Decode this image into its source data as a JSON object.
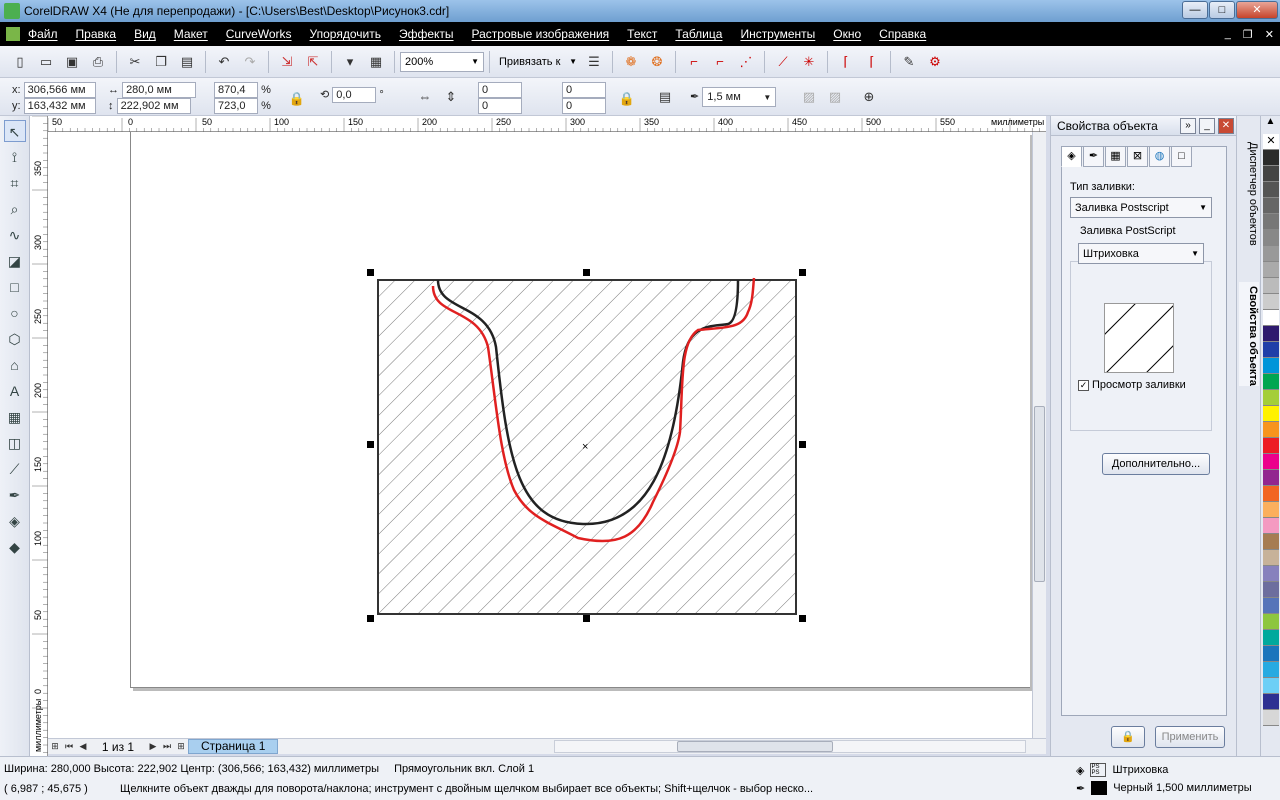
{
  "window": {
    "title": "CorelDRAW X4 (Не для перепродажи) - [C:\\Users\\Best\\Desktop\\Рисунок3.cdr]"
  },
  "menu": [
    "Файл",
    "Правка",
    "Вид",
    "Макет",
    "CurveWorks",
    "Упорядочить",
    "Эффекты",
    "Растровые изображения",
    "Текст",
    "Таблица",
    "Инструменты",
    "Окно",
    "Справка"
  ],
  "toolbar": {
    "zoom": "200%",
    "snap": "Привязать к"
  },
  "props": {
    "x_label": "x:",
    "x": "306,566 мм",
    "y_label": "y:",
    "y": "163,432 мм",
    "w": "280,0 мм",
    "h": "222,902 мм",
    "sx": "870,4",
    "sy": "723,0",
    "pct": "%",
    "rot": "0,0",
    "deg": "°",
    "c1": "0",
    "c2": "0",
    "c3": "0",
    "c4": "0",
    "outline": "1,5 мм"
  },
  "rulers": {
    "top": [
      "50",
      "0",
      "50",
      "100",
      "150",
      "200",
      "250",
      "300",
      "350",
      "400",
      "450",
      "500",
      "550"
    ],
    "unit": "миллиметры",
    "left": [
      "350",
      "300",
      "250",
      "200",
      "150",
      "100",
      "50",
      "0"
    ]
  },
  "pages": {
    "count": "1 из 1",
    "tab": "Страница 1"
  },
  "docker": {
    "title": "Свойства объекта",
    "fill_type_label": "Тип заливки:",
    "fill_type": "Заливка Postscript",
    "ps_group": "Заливка PostScript",
    "ps_pattern": "Штриховка",
    "preview_label": "Просмотр заливки",
    "more_button": "Дополнительно...",
    "apply_button": "Применить",
    "side_tab1": "Диспетчер объектов",
    "side_tab2": "Свойства объекта"
  },
  "status": {
    "dims": "Ширина: 280,000  Высота: 222,902  Центр: (306,566; 163,432)  миллиметры",
    "object": "Прямоугольник вкл. Слой 1",
    "coords": "( 6,987 ; 45,675 )",
    "hint": "Щелкните объект дважды для поворота/наклона; инструмент с двойным щелчком выбирает все объекты; Shift+щелчок - выбор неско...",
    "fill": "Штриховка",
    "stroke": "Черный  1,500 миллиметры"
  },
  "palette": [
    "#ffffff",
    "#2b2b2b",
    "#444444",
    "#555555",
    "#666666",
    "#777777",
    "#888888",
    "#999999",
    "#aaaaaa",
    "#bbbbbb",
    "#cccccc",
    "#ffffff",
    "#2e1a6e",
    "#1f3fa8",
    "#0095d9",
    "#00a651",
    "#a4ce39",
    "#fff200",
    "#f7941d",
    "#ed1c24",
    "#ec008c",
    "#92278f",
    "#f26522",
    "#fbaf5d",
    "#f49ac1",
    "#a67c52",
    "#c7b299",
    "#8781bd",
    "#6d6e9e",
    "#5674b9",
    "#8dc63f",
    "#00a99d",
    "#1b75bc",
    "#27aae1",
    "#6dcff6",
    "#2e3192",
    "#d7d7d7"
  ]
}
